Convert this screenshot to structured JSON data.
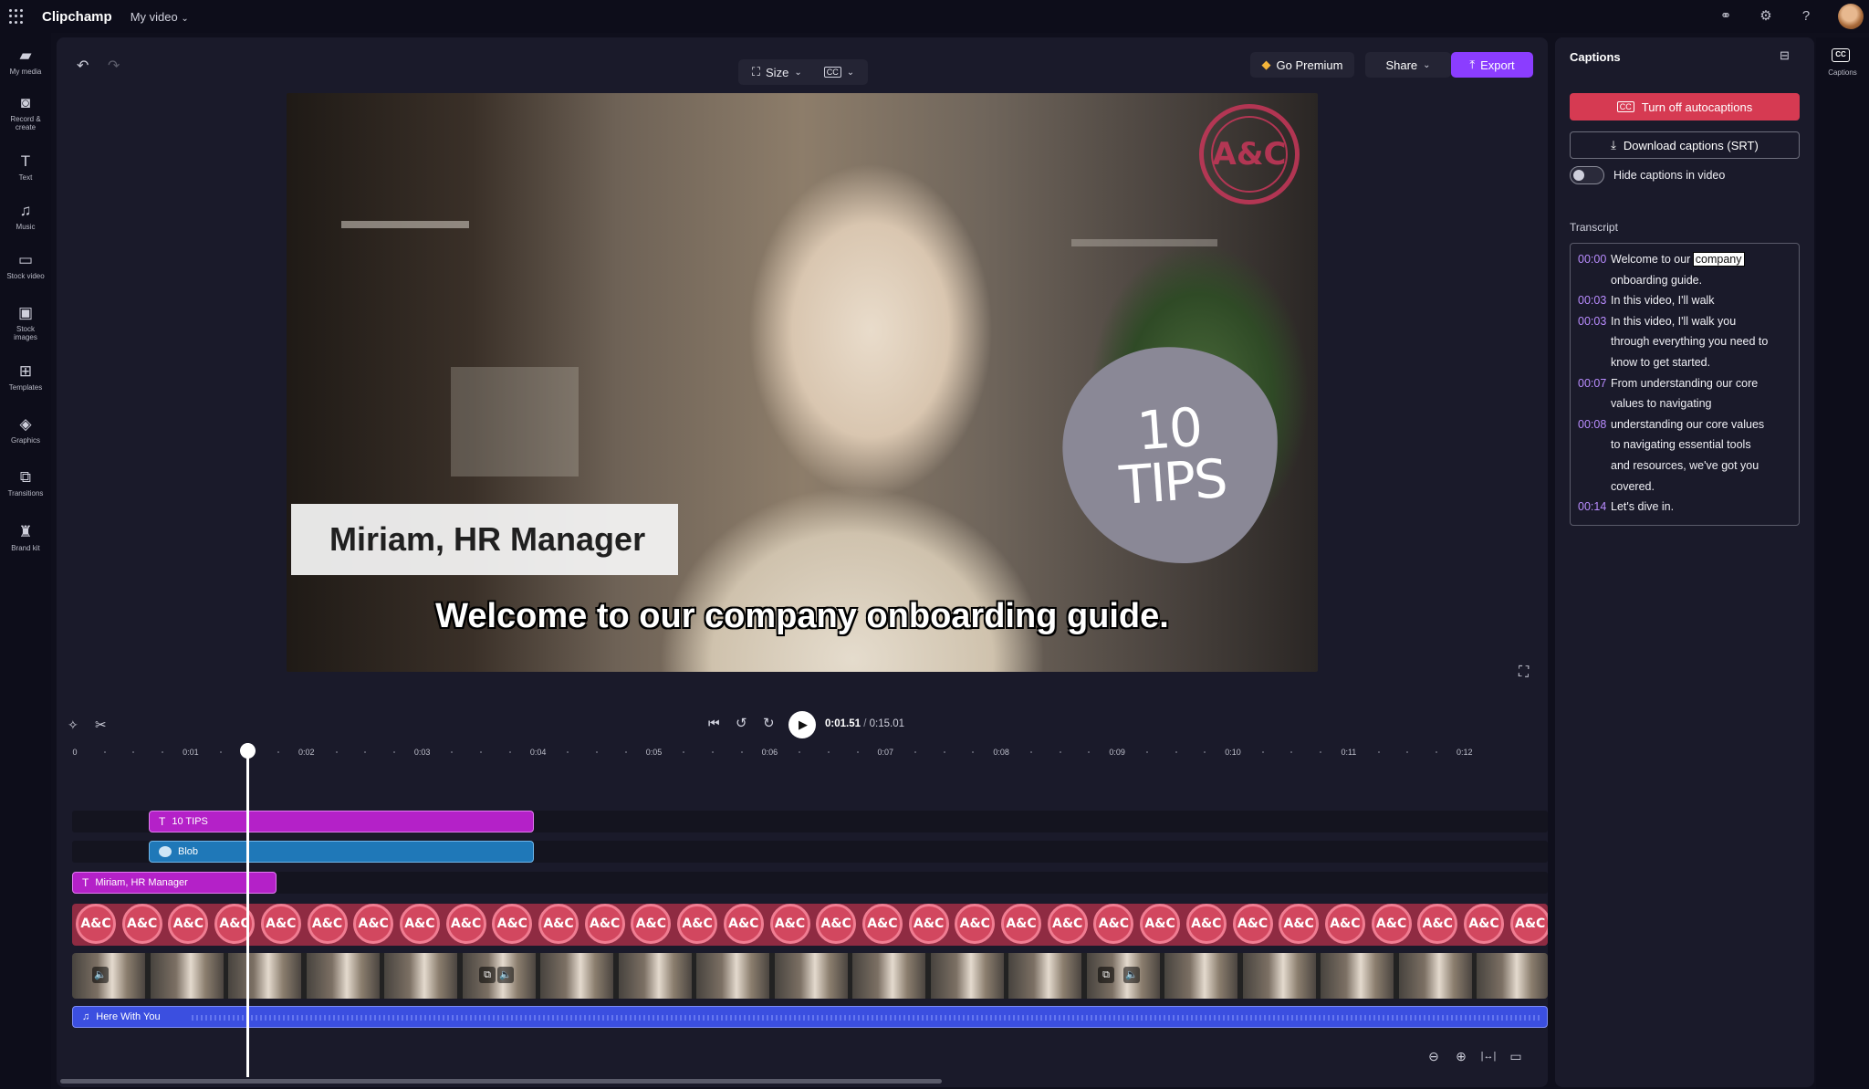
{
  "topbar": {
    "app_title": "Clipchamp",
    "project_name": "My video"
  },
  "leftnav": [
    {
      "label": "My media",
      "icon": "folder-icon"
    },
    {
      "label": "Record & create",
      "icon": "camera-icon"
    },
    {
      "label": "Text",
      "icon": "text-icon"
    },
    {
      "label": "Music",
      "icon": "music-note-icon"
    },
    {
      "label": "Stock video",
      "icon": "film-icon"
    },
    {
      "label": "Stock images",
      "icon": "image-icon"
    },
    {
      "label": "Templates",
      "icon": "templates-icon"
    },
    {
      "label": "Graphics",
      "icon": "shapes-icon"
    },
    {
      "label": "Transitions",
      "icon": "transitions-icon"
    },
    {
      "label": "Brand kit",
      "icon": "brand-kit-icon"
    }
  ],
  "toolbar": {
    "size_label": "Size",
    "go_premium_label": "Go Premium",
    "share_label": "Share",
    "export_label": "Export"
  },
  "preview": {
    "logo_text": "A&C",
    "sticker_line1": "10",
    "sticker_line2": "TIPS",
    "lower_third": "Miriam, HR Manager",
    "caption": "Welcome to our company onboarding guide."
  },
  "captions_panel": {
    "title": "Captions",
    "turn_off_label": "Turn off autocaptions",
    "download_label": "Download captions (SRT)",
    "hide_label": "Hide captions in video",
    "transcript_heading": "Transcript",
    "transcript": [
      {
        "time": "00:00",
        "pre": "Welcome to our ",
        "highlight": "company",
        "lines": [
          "onboarding guide."
        ]
      },
      {
        "time": "00:03",
        "text": "In this video, I'll walk",
        "lines": []
      },
      {
        "time": "00:03",
        "text": "In this video, I'll walk you",
        "lines": [
          "through everything you need to",
          "know to get started."
        ]
      },
      {
        "time": "00:07",
        "text": "From understanding our core",
        "lines": [
          "values to navigating"
        ]
      },
      {
        "time": "00:08",
        "text": "understanding our core values",
        "lines": [
          "to navigating essential tools",
          "and resources, we've got you",
          "covered."
        ]
      },
      {
        "time": "00:14",
        "text": "Let's dive in.",
        "lines": []
      }
    ]
  },
  "rightrail": {
    "captions_label": "Captions"
  },
  "playback": {
    "current_time": "0:01.51",
    "separator": "/",
    "total_time": "0:15.01"
  },
  "ruler": [
    "0",
    "0:01",
    "0:02",
    "0:03",
    "0:04",
    "0:05",
    "0:06",
    "0:07",
    "0:08",
    "0:09",
    "0:10",
    "0:11",
    "0:12"
  ],
  "tracks": {
    "text_track": "10 TIPS",
    "blob_track": "Blob",
    "lower_third_track": "Miriam, HR Manager",
    "audio_track": "Here With You",
    "logo_clip_text": "A&C"
  },
  "colors": {
    "accent": "#8b3dff",
    "caption_red": "#d63a52",
    "text_track": "#b421c8",
    "blob_track": "#1f78b8",
    "audio_track": "#3b4fe0",
    "timestamp": "#b98cff"
  }
}
